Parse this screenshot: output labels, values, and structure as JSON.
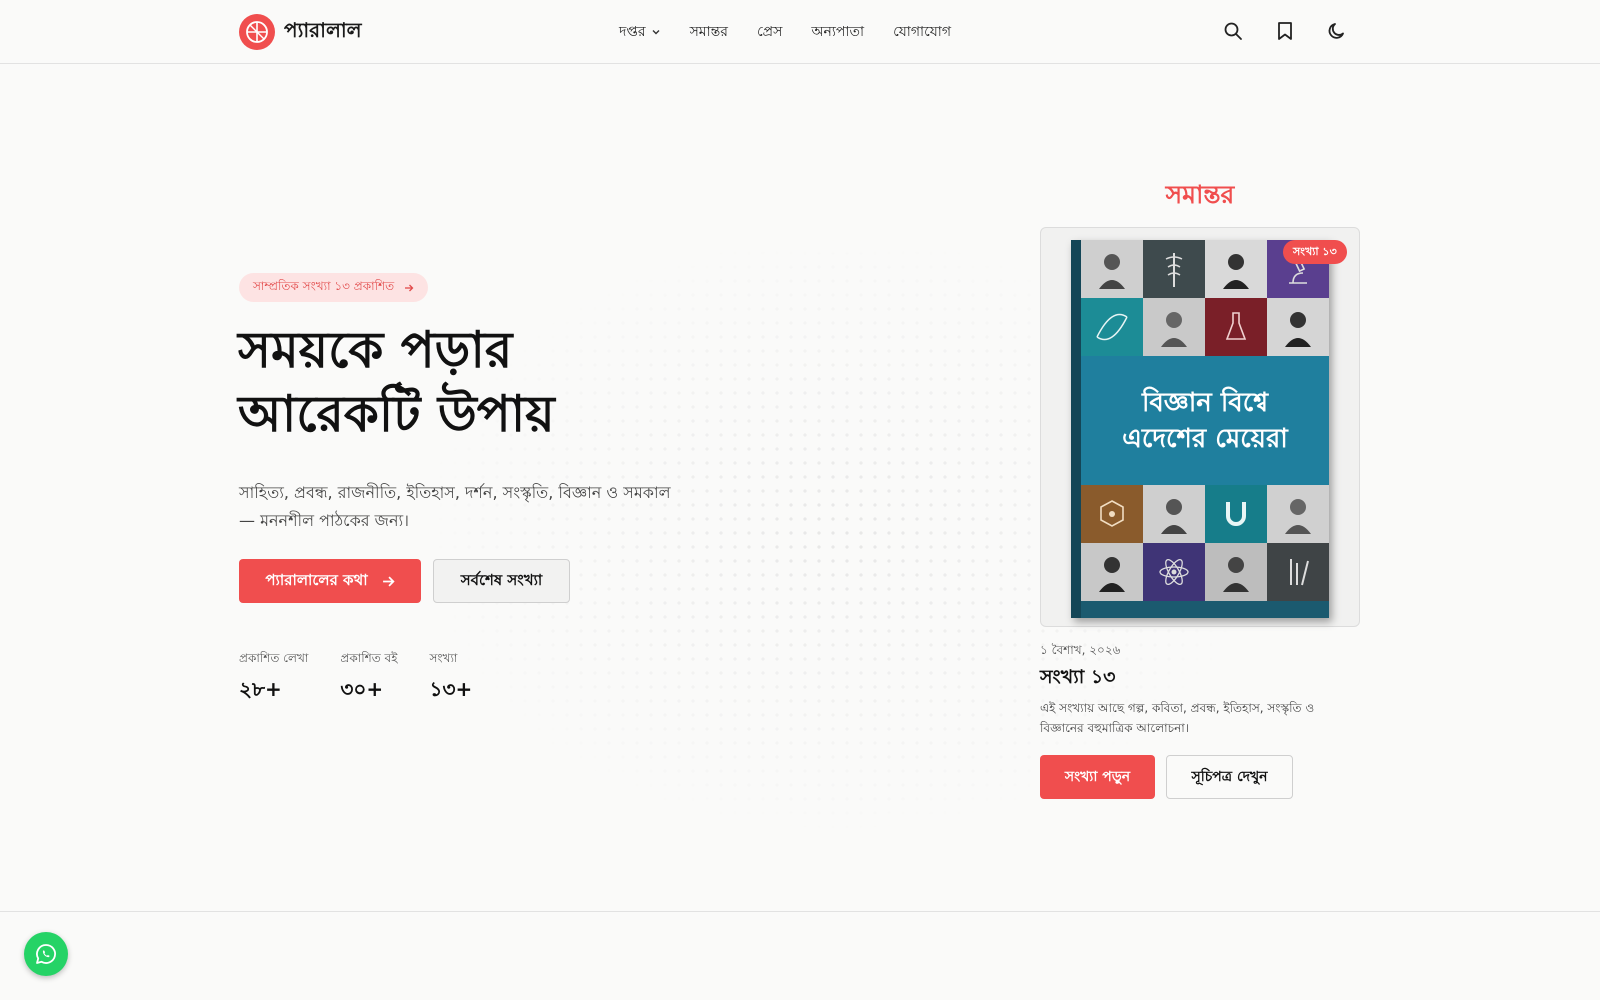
{
  "brand": {
    "name": "প্যারালাল",
    "logo_icon": "aperture-logo-icon",
    "accent": "#f04e4e"
  },
  "nav": {
    "items": [
      {
        "label": "দপ্তর",
        "has_dropdown": true
      },
      {
        "label": "সমান্তর"
      },
      {
        "label": "প্রেস"
      },
      {
        "label": "অন্যপাতা"
      },
      {
        "label": "যোগাযোগ"
      }
    ]
  },
  "header_icons": [
    "search-icon",
    "bookmark-icon",
    "moon-icon"
  ],
  "hero": {
    "pill": "সাম্প্রতিক সংখ্যা ১৩ প্রকাশিত",
    "headline_line1": "সময়কে পড়ার",
    "headline_line2": "আরেকটি উপায়",
    "subtitle": "সাহিত্য, প্রবন্ধ, রাজনীতি, ইতিহাস, দর্শন, সংস্কৃতি, বিজ্ঞান ও সমকাল — মননশীল পাঠকের জন্য।",
    "primary_button": "প্যারালালের কথা",
    "secondary_button": "সর্বশেষ সংখ্যা",
    "stats": [
      {
        "label": "প্রকাশিত লেখা",
        "value": "২৮+"
      },
      {
        "label": "প্রকাশিত বই",
        "value": "৩০+"
      },
      {
        "label": "সংখ্যা",
        "value": "১৩+"
      }
    ]
  },
  "issue": {
    "section_title": "সমান্তর",
    "badge": "সংখ্যা ১৩",
    "cover_title_line1": "বিজ্ঞান বিশ্বে",
    "cover_title_line2": "এদেশের মেয়েরা",
    "date": "১ বৈশাখ, ২০২৬",
    "name": "সংখ্যা ১৩",
    "description": "এই সংখ্যায় আছে গল্প, কবিতা, প্রবন্ধ, ইতিহাস, সংস্কৃতি ও বিজ্ঞানের বহুমাত্রিক আলোচনা।",
    "read_button": "সংখ্যা পড়ুন",
    "toc_button": "সূচিপত্র দেখুন"
  },
  "floating": {
    "whatsapp_icon": "whatsapp-icon"
  }
}
